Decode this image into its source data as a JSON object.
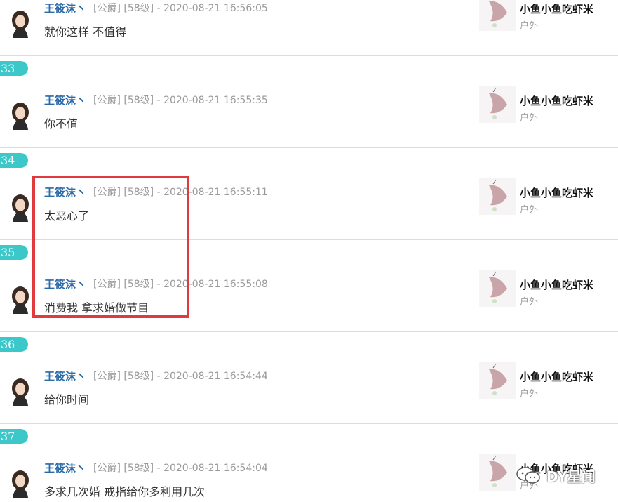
{
  "comments": [
    {
      "user": "王筱沫丶",
      "meta": "[公爵] [58级] - 2020-08-21 16:56:05",
      "message": "就你这样 不值得",
      "target_name": "小鱼小鱼吃虾米",
      "target_tag": "户外"
    },
    {
      "floor": "33",
      "user": "王筱沫丶",
      "meta": "[公爵] [58级] - 2020-08-21 16:55:35",
      "message": "你不值",
      "target_name": "小鱼小鱼吃虾米",
      "target_tag": "户外"
    },
    {
      "floor": "34",
      "user": "王筱沫丶",
      "meta": "[公爵] [58级] - 2020-08-21 16:55:11",
      "message": "太恶心了",
      "target_name": "小鱼小鱼吃虾米",
      "target_tag": "户外"
    },
    {
      "floor": "35",
      "user": "王筱沫丶",
      "meta": "[公爵] [58级] - 2020-08-21 16:55:08",
      "message": "消费我 拿求婚做节目",
      "target_name": "小鱼小鱼吃虾米",
      "target_tag": "户外"
    },
    {
      "floor": "36",
      "user": "王筱沫丶",
      "meta": "[公爵] [58级] - 2020-08-21 16:54:44",
      "message": "给你时间",
      "target_name": "小鱼小鱼吃虾米",
      "target_tag": "户外"
    },
    {
      "floor": "37",
      "user": "王筱沫丶",
      "meta": "[公爵] [58级] - 2020-08-21 16:54:04",
      "message": "多求几次婚 戒指给你多利用几次",
      "target_name": "小鱼小鱼吃虾米",
      "target_tag": "户外"
    }
  ],
  "watermark": {
    "text": "DY星闻",
    "icon": "wechat-icon"
  },
  "colors": {
    "floor_badge": "#3cc7c9",
    "username": "#2b6aa8",
    "highlight_box": "#e0393e"
  }
}
